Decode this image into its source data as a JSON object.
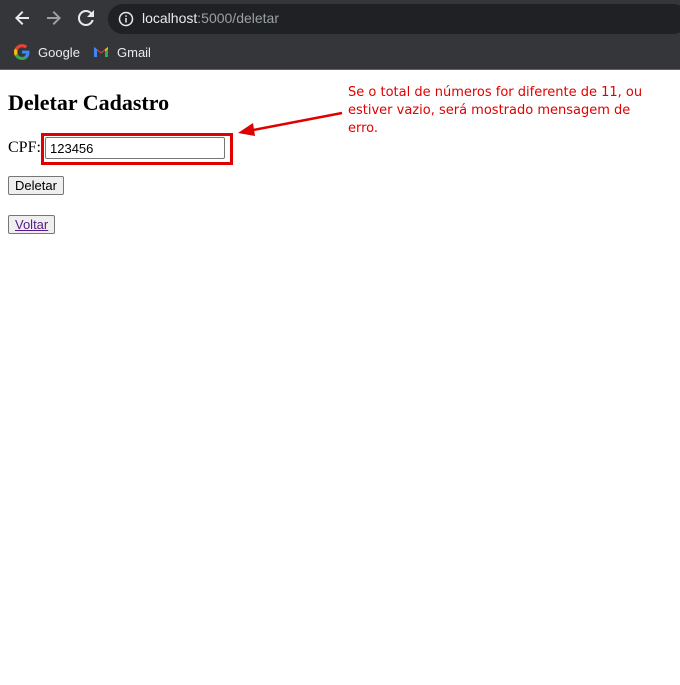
{
  "browser": {
    "url_host": "localhost",
    "url_rest": ":5000/deletar",
    "bookmarks": [
      {
        "label": "Google",
        "icon": "google-icon"
      },
      {
        "label": "Gmail",
        "icon": "gmail-icon"
      }
    ]
  },
  "page": {
    "title": "Deletar Cadastro",
    "cpf_label": "CPF:",
    "cpf_value": "123456",
    "delete_button": "Deletar",
    "back_link": "Voltar"
  },
  "annotation": {
    "text": "Se o total de números for diferente de 11, ou estiver vazio, será mostrado mensagem de erro.",
    "color": "#e00000"
  }
}
